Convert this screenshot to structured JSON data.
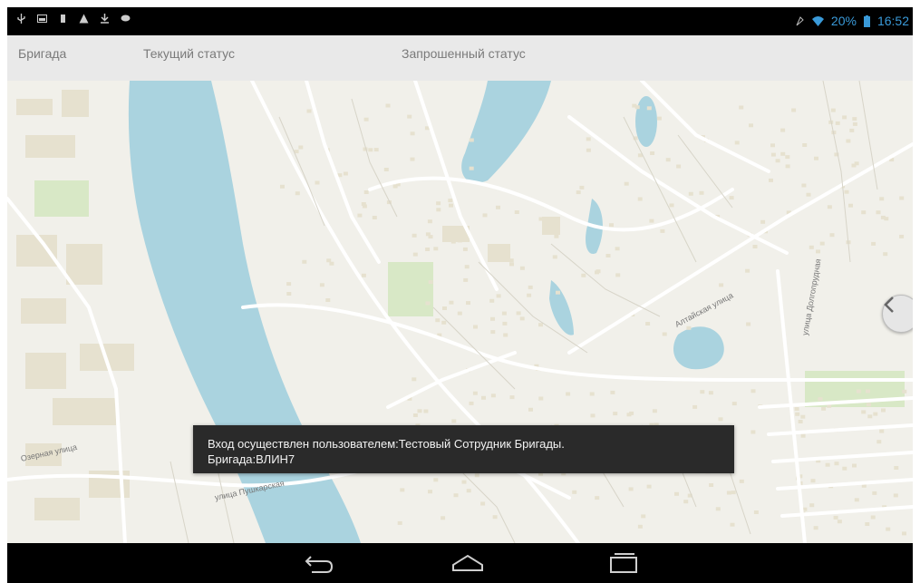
{
  "status_bar": {
    "left_icons": [
      "usb-icon",
      "gallery-icon",
      "sim-icon",
      "warning-icon",
      "download-icon",
      "chat-icon"
    ],
    "right_icons": [
      "alarm-icon",
      "wifi-icon",
      "battery-icon"
    ],
    "battery": "20%",
    "time": "16:52"
  },
  "header": {
    "col_brigade": "Бригада",
    "col_current_status": "Текущий статус",
    "col_requested_status": "Запрошенный статус"
  },
  "map": {
    "streets": [
      "Озерная улица",
      "улица Пушкарская",
      "Алтайская улица",
      "улица Долгопрудная"
    ],
    "colors": {
      "land": "#f1f0ea",
      "water": "#aad3df",
      "green": "#d8e8c6",
      "road": "#ffffff",
      "road_outline": "#d7d4c8",
      "building": "#e6e1cf"
    }
  },
  "side_button": {
    "icon": "chevron-left-icon"
  },
  "toast": {
    "line1": "Вход осуществлен пользователем:Тестовый  Сотрудник Бригады.",
    "line2": "Бригада:ВЛИН7"
  },
  "nav_bar": {
    "back": "back-icon",
    "home": "home-icon",
    "recents": "recents-icon"
  }
}
